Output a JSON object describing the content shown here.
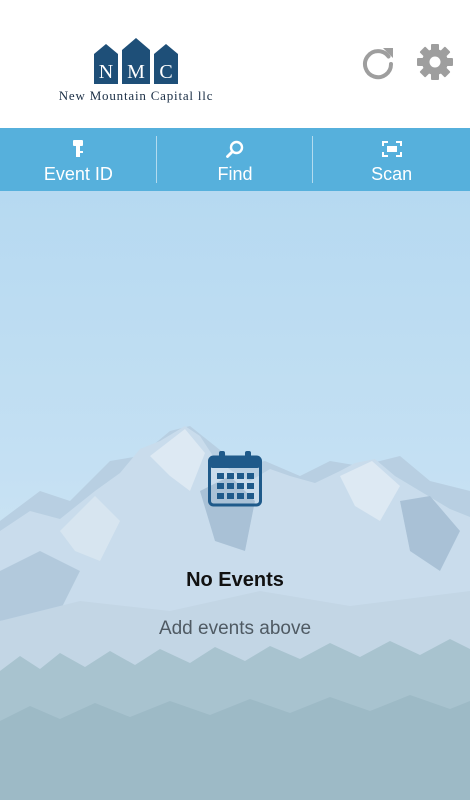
{
  "header": {
    "logo": {
      "letters": [
        "N",
        "M",
        "C"
      ],
      "company_name": "New Mountain Capital llc"
    },
    "refresh_icon": "refresh-icon",
    "settings_icon": "gear-icon"
  },
  "toolbar": {
    "items": [
      {
        "label": "Event ID",
        "icon": "key-icon"
      },
      {
        "label": "Find",
        "icon": "search-icon"
      },
      {
        "label": "Scan",
        "icon": "scan-icon"
      }
    ]
  },
  "empty_state": {
    "icon": "calendar-icon",
    "title": "No Events",
    "subtitle": "Add events above"
  },
  "colors": {
    "toolbar_bg": "#56b0dc",
    "logo_blue": "#1e4f78",
    "header_icon_gray": "#9e9e9e",
    "calendar_blue": "#1f5a8a"
  }
}
